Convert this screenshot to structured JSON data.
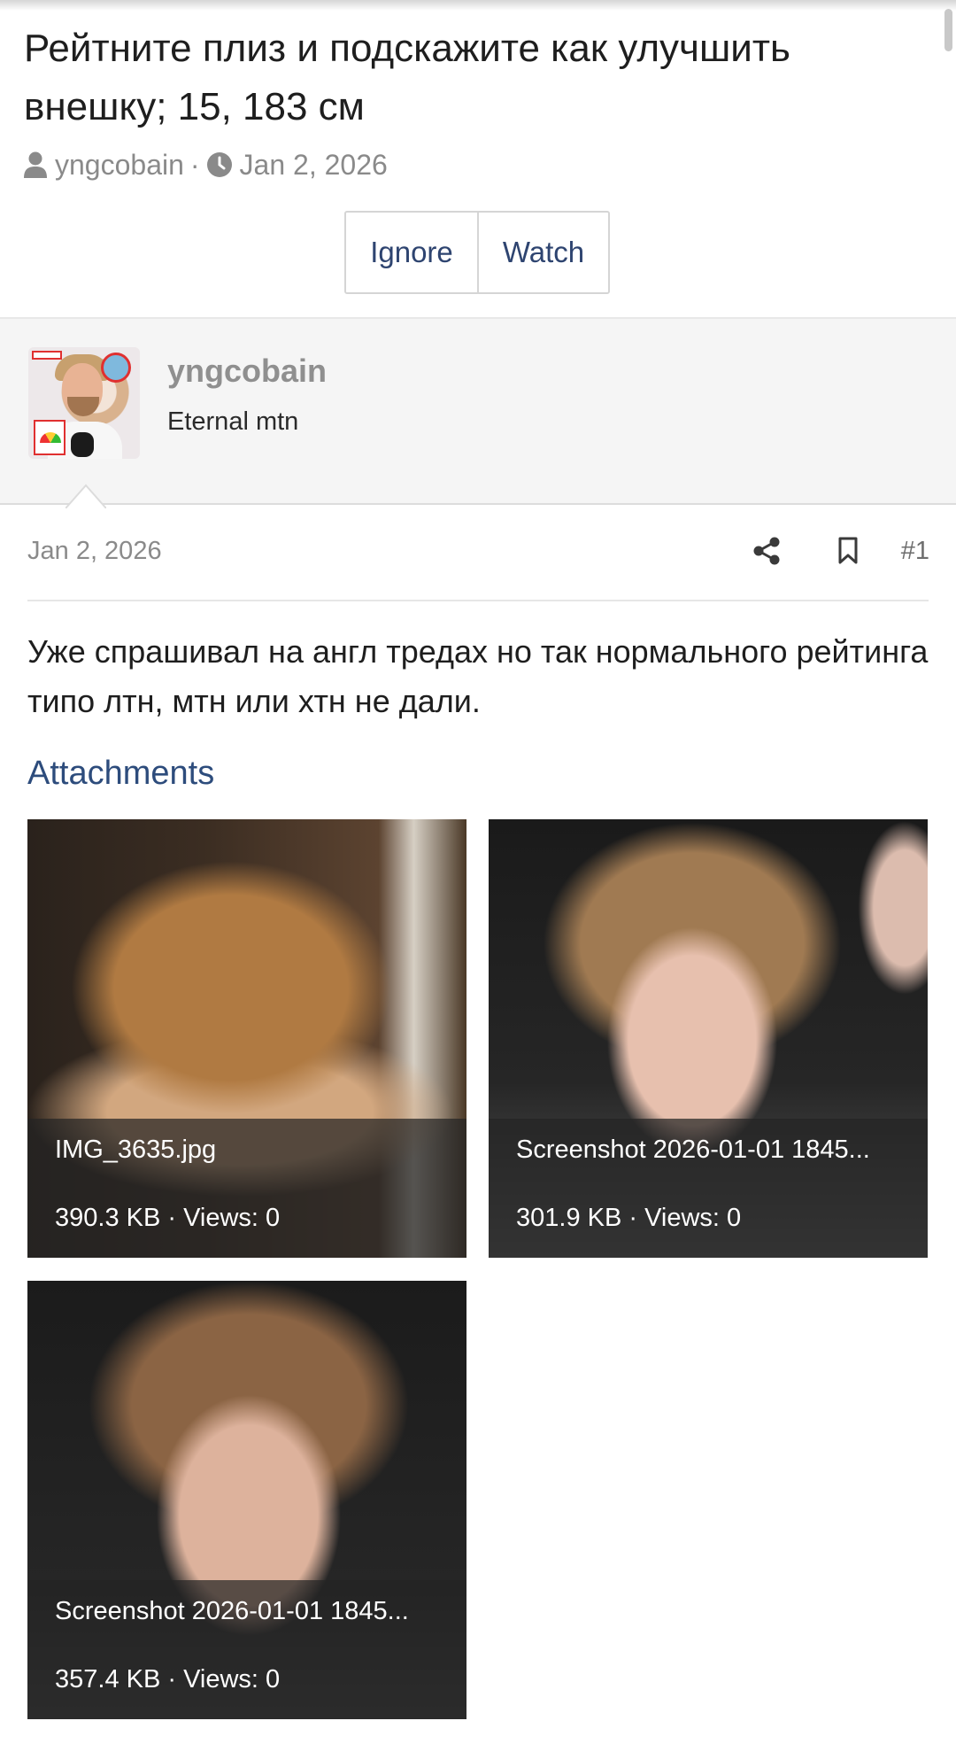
{
  "thread": {
    "title": "Рейтните плиз и подскажите как улучшить внешку; 15, 183 см",
    "author": "yngcobain",
    "separator": "·",
    "date": "Jan 2, 2026"
  },
  "actions": {
    "ignore_label": "Ignore",
    "watch_label": "Watch"
  },
  "user": {
    "name": "yngcobain",
    "title": "Eternal mtn"
  },
  "post": {
    "date": "Jan 2, 2026",
    "number": "#1",
    "body": "Уже спрашивал на англ тредах но так нормального рейтинга типо лтн, мтн или хтн не дали."
  },
  "attachments": {
    "heading": "Attachments",
    "items": [
      {
        "filename": "IMG_3635.jpg",
        "meta": "390.3 KB · Views: 0"
      },
      {
        "filename": "Screenshot 2026-01-01 1845...",
        "meta": "301.9 KB · Views: 0"
      },
      {
        "filename": "Screenshot 2026-01-01 1845...",
        "meta": "357.4 KB · Views: 0"
      }
    ]
  },
  "colors": {
    "link": "#2e4470",
    "attachments_heading": "#2d4c7c",
    "muted": "#8a8a8a"
  },
  "icons": [
    "user-icon",
    "clock-icon",
    "share-icon",
    "bookmark-icon"
  ]
}
